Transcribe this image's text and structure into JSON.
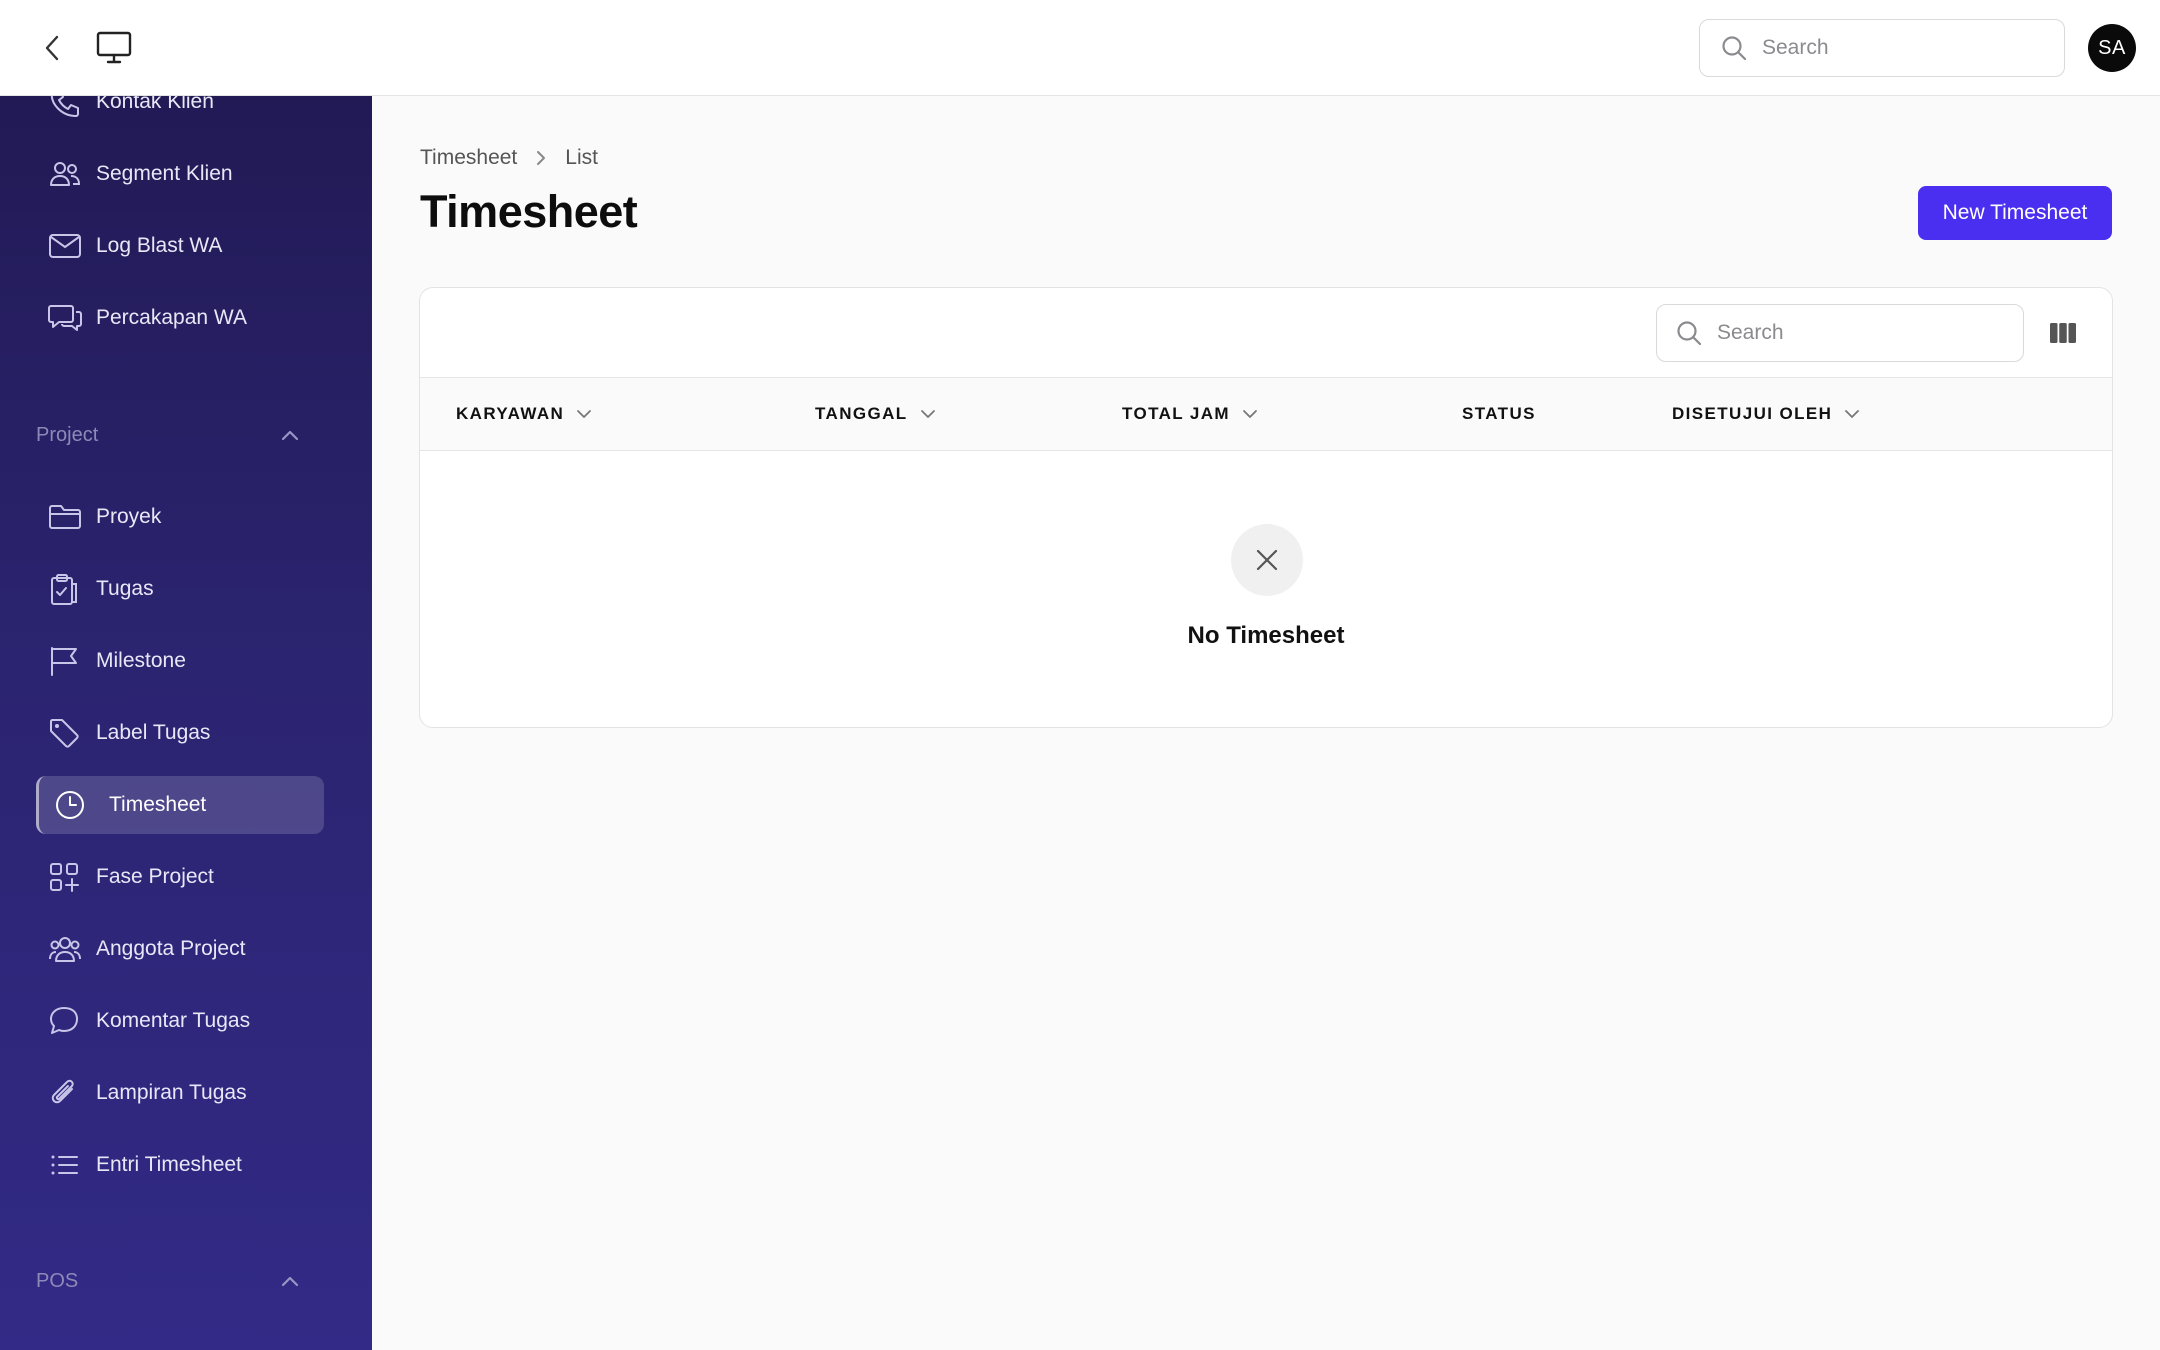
{
  "topbar": {
    "search_placeholder": "Search",
    "avatar_initials": "SA"
  },
  "sidebar": {
    "items_top": [
      {
        "label": "Kontak Klien",
        "icon": "phone-icon"
      },
      {
        "label": "Segment Klien",
        "icon": "users-icon"
      },
      {
        "label": "Log Blast WA",
        "icon": "mail-icon"
      },
      {
        "label": "Percakapan WA",
        "icon": "chat-icon"
      }
    ],
    "section_project": "Project",
    "items_project": [
      {
        "label": "Proyek",
        "icon": "folder-icon"
      },
      {
        "label": "Tugas",
        "icon": "clipboard-check-icon"
      },
      {
        "label": "Milestone",
        "icon": "flag-icon"
      },
      {
        "label": "Label Tugas",
        "icon": "tag-icon"
      },
      {
        "label": "Timesheet",
        "icon": "clock-icon",
        "active": true
      },
      {
        "label": "Fase Project",
        "icon": "squares-plus-icon"
      },
      {
        "label": "Anggota Project",
        "icon": "user-group-icon"
      },
      {
        "label": "Komentar Tugas",
        "icon": "comment-icon"
      },
      {
        "label": "Lampiran Tugas",
        "icon": "paperclip-icon"
      },
      {
        "label": "Entri Timesheet",
        "icon": "list-icon"
      }
    ],
    "section_pos": "POS"
  },
  "breadcrumb": {
    "root": "Timesheet",
    "current": "List"
  },
  "page": {
    "title": "Timesheet",
    "new_button": "New Timesheet"
  },
  "table": {
    "search_placeholder": "Search",
    "columns": [
      {
        "label": "KARYAWAN",
        "sortable": true
      },
      {
        "label": "TANGGAL",
        "sortable": true
      },
      {
        "label": "TOTAL JAM",
        "sortable": true
      },
      {
        "label": "STATUS",
        "sortable": false
      },
      {
        "label": "DISETUJUI OLEH",
        "sortable": true
      }
    ],
    "empty_text": "No Timesheet"
  },
  "colors": {
    "accent": "#4b2ff0",
    "sidebar_top": "#221a55",
    "sidebar_bottom": "#322a86"
  }
}
